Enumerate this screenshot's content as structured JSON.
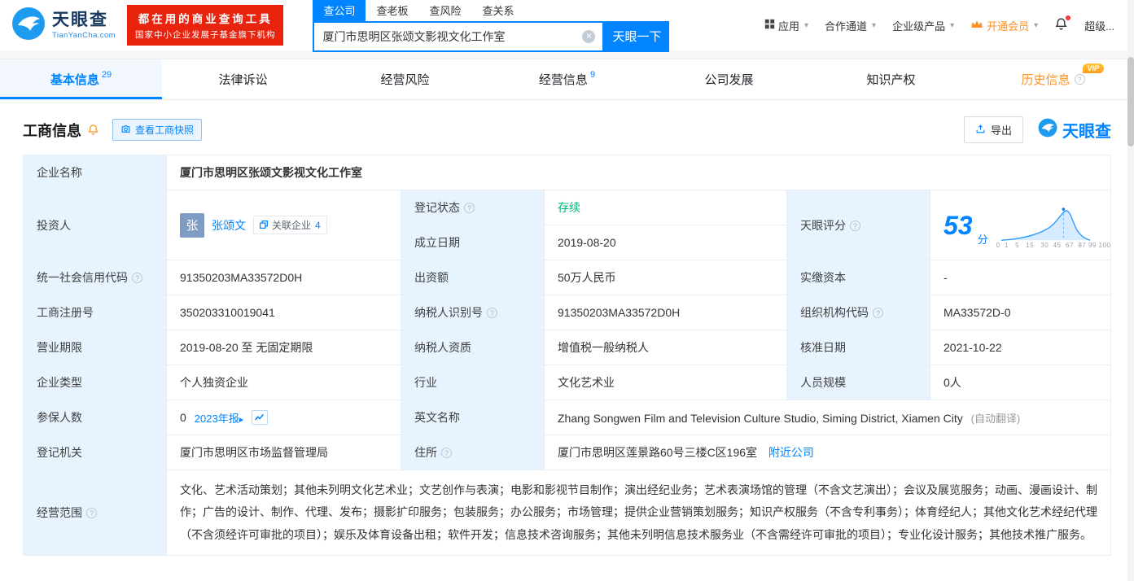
{
  "header": {
    "logo": {
      "title": "天眼查",
      "subtitle": "TianYanCha.com"
    },
    "promo": {
      "line1": "都在用的商业查询工具",
      "line2": "国家中小企业发展子基金旗下机构"
    },
    "search": {
      "tabs": [
        {
          "label": "查公司"
        },
        {
          "label": "查老板"
        },
        {
          "label": "查风险"
        },
        {
          "label": "查关系"
        }
      ],
      "value": "厦门市思明区张颂文影视文化工作室",
      "button": "天眼一下"
    },
    "menu": {
      "apps": "应用",
      "partner": "合作通道",
      "enterprise": "企业级产品",
      "vip": "开通会员",
      "super": "超级..."
    }
  },
  "nav": {
    "tabs": [
      {
        "label": "基本信息",
        "count": "29"
      },
      {
        "label": "法律诉讼"
      },
      {
        "label": "经营风险"
      },
      {
        "label": "经营信息",
        "count": "9"
      },
      {
        "label": "公司发展"
      },
      {
        "label": "知识产权"
      },
      {
        "label": "历史信息"
      }
    ],
    "vip_badge": "VIP"
  },
  "section": {
    "title": "工商信息",
    "snapshot_button": "查看工商快照",
    "export_button": "导出",
    "brand": "天眼查"
  },
  "info": {
    "name_label": "企业名称",
    "name": "厦门市思明区张颂文影视文化工作室",
    "investor_label": "投资人",
    "investor_avatar": "张",
    "investor_name": "张颂文",
    "related_text": "关联企业",
    "related_count": "4",
    "status_label": "登记状态",
    "status": "存续",
    "established_label": "成立日期",
    "established": "2019-08-20",
    "score_label": "天眼评分",
    "score": "53",
    "score_unit": "分",
    "score_axis": "0  1   5   15   30  45  67  87 99 100",
    "credit_code_label": "统一社会信用代码",
    "credit_code": "91350203MA33572D0H",
    "capital_label": "出资额",
    "capital": "50万人民币",
    "paid_capital_label": "实缴资本",
    "paid_capital": "-",
    "reg_no_label": "工商注册号",
    "reg_no": "350203310019041",
    "tax_id_label": "纳税人识别号",
    "tax_id": "91350203MA33572D0H",
    "org_code_label": "组织机构代码",
    "org_code": "MA33572D-0",
    "term_label": "营业期限",
    "term": "2019-08-20 至 无固定期限",
    "tax_quality_label": "纳税人资质",
    "tax_quality": "增值税一般纳税人",
    "approved_label": "核准日期",
    "approved": "2021-10-22",
    "type_label": "企业类型",
    "type": "个人独资企业",
    "industry_label": "行业",
    "industry": "文化艺术业",
    "staff_label": "人员规模",
    "staff": "0人",
    "insured_label": "参保人数",
    "insured": "0",
    "annual_report": "2023年报",
    "en_name_label": "英文名称",
    "en_name": "Zhang Songwen Film and Television Culture Studio, Siming District, Xiamen City",
    "auto_translate": "(自动翻译)",
    "authority_label": "登记机关",
    "authority": "厦门市思明区市场监督管理局",
    "address_label": "住所",
    "address": "厦门市思明区莲景路60号三楼C区196室",
    "nearby_link": "附近公司",
    "scope_label": "经营范围",
    "scope": "文化、艺术活动策划；其他未列明文化艺术业；文艺创作与表演；电影和影视节目制作；演出经纪业务；艺术表演场馆的管理（不含文艺演出）；会议及展览服务；动画、漫画设计、制作；广告的设计、制作、代理、发布；摄影扩印服务；包装服务；办公服务；市场管理；提供企业营销策划服务；知识产权服务（不含专利事务）；体育经纪人；其他文化艺术经纪代理（不含须经许可审批的项目）；娱乐及体育设备出租；软件开发；信息技术咨询服务；其他未列明信息技术服务业（不含需经许可审批的项目）；专业化设计服务；其他技术推广服务。"
  },
  "colors": {
    "primary": "#0084ff",
    "status_green": "#00b578",
    "history_orange": "#ff9224",
    "promo_red": "#e8240f",
    "label_bg": "#e7f3ff"
  }
}
